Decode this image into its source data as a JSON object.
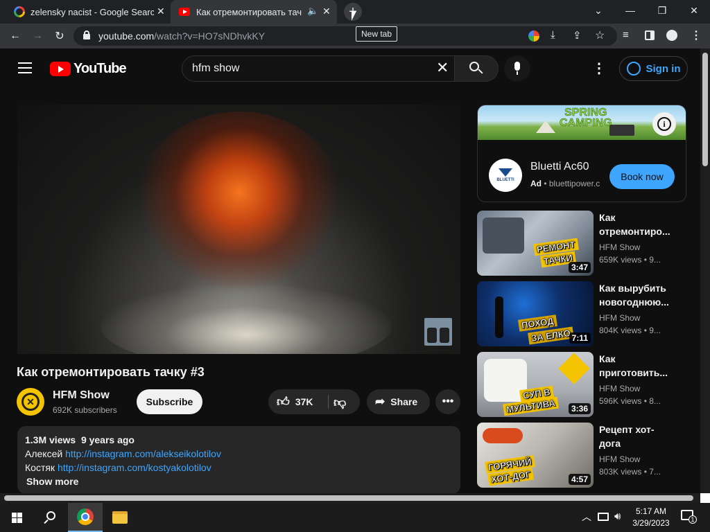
{
  "browser": {
    "tabs": [
      {
        "title": "zelensky nacist - Google Search",
        "icon": "google-icon"
      },
      {
        "title": "Как отремонтировать тачку",
        "icon": "youtube-icon",
        "audio": true
      }
    ],
    "new_tab_tooltip": "New tab",
    "url_host": "youtube.com",
    "url_path": "/watch?v=HO7sNDhvkKY"
  },
  "youtube": {
    "logo_text": "YouTube",
    "search_value": "hfm show",
    "sign_in_label": "Sign in",
    "video": {
      "title": "Как отремонтировать тачку #3",
      "channel": "HFM Show",
      "subscribers": "692K subscribers",
      "subscribe_label": "Subscribe",
      "likes": "37K",
      "share_label": "Share"
    },
    "description": {
      "views": "1.3M views",
      "age": "9 years ago",
      "line1_name": "Алексей",
      "line1_link": "http://instagram.com/alekseikolotilov",
      "line2_name": "Костяк",
      "line2_link": "http://instagram.com/kostyakolotilov",
      "show_more": "Show more"
    },
    "ad": {
      "banner_line1": "SPRING",
      "banner_line2": "CAMPING",
      "logo_text": "BLUETTI",
      "title": "Bluetti Ac60",
      "badge": "Ad",
      "domain": "bluettipower.c",
      "cta": "Book now"
    },
    "recommendations": [
      {
        "title_l1": "Как",
        "title_l2": "отремонтиро...",
        "channel": "HFM Show",
        "views": "659K views  •  9...",
        "duration": "3:47",
        "thumb_text_1": "РЕМОНТ",
        "thumb_text_2": "ТАЧКИ"
      },
      {
        "title_l1": "Как вырубить",
        "title_l2": "новогоднюю...",
        "channel": "HFM Show",
        "views": "804K views  •  9...",
        "duration": "7:11",
        "thumb_text_1": "ПОХОД",
        "thumb_text_2": "ЗА ЕЛКО"
      },
      {
        "title_l1": "Как",
        "title_l2": "приготовить...",
        "channel": "HFM Show",
        "views": "596K views  •  8...",
        "duration": "3:36",
        "thumb_text_1": "СУП В",
        "thumb_text_2": "МУЛЬТИВА"
      },
      {
        "title_l1": "Рецепт хот-",
        "title_l2": "дога",
        "channel": "HFM Show",
        "views": "803K views  •  7...",
        "duration": "4:57",
        "thumb_text_1": "ГОРЯЧИЙ",
        "thumb_text_2": "ХОТ-ДОГ"
      }
    ]
  },
  "taskbar": {
    "time": "5:17 AM",
    "date": "3/29/2023",
    "notification_count": "1"
  }
}
